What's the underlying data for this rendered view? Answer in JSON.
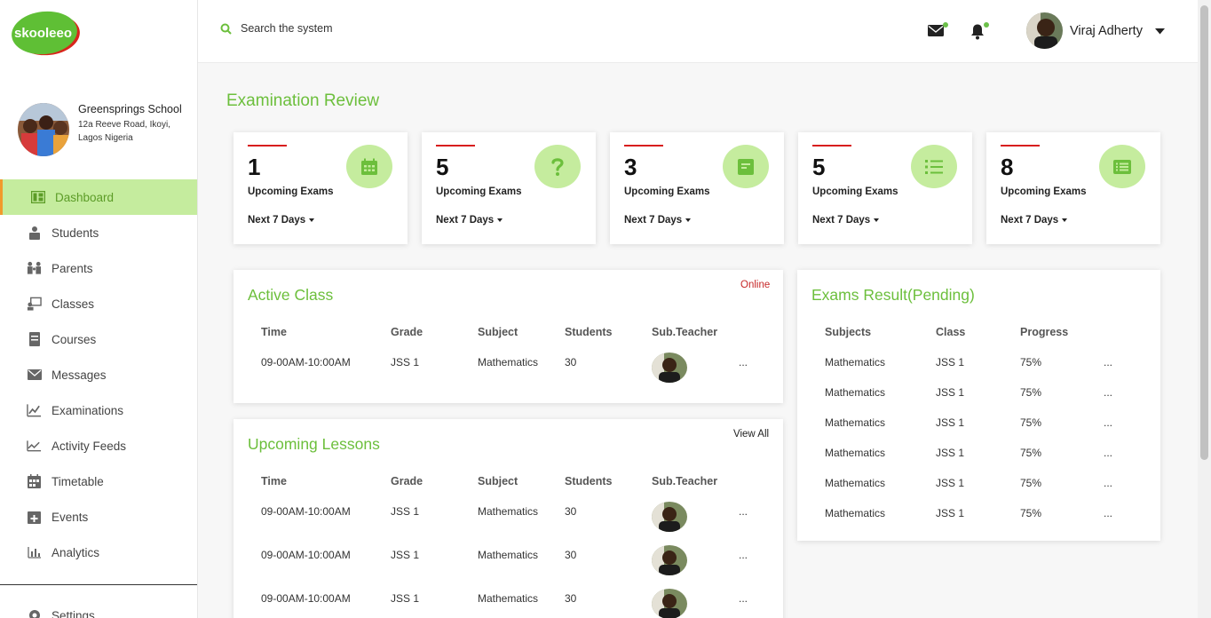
{
  "app": {
    "logo_text": "skooleeo"
  },
  "school": {
    "name": "Greensprings School",
    "address_line1": "12a Reeve Road, Ikoyi,",
    "address_line2": "Lagos Nigeria"
  },
  "sidebar": {
    "items": [
      {
        "label": "Dashboard",
        "icon": "dashboard-icon"
      },
      {
        "label": "Students",
        "icon": "students-icon"
      },
      {
        "label": "Parents",
        "icon": "parents-icon"
      },
      {
        "label": "Classes",
        "icon": "classes-icon"
      },
      {
        "label": "Courses",
        "icon": "courses-icon"
      },
      {
        "label": "Messages",
        "icon": "messages-icon"
      },
      {
        "label": "Examinations",
        "icon": "examinations-icon"
      },
      {
        "label": "Activity Feeds",
        "icon": "activity-icon"
      },
      {
        "label": "Timetable",
        "icon": "timetable-icon"
      },
      {
        "label": "Events",
        "icon": "events-icon"
      },
      {
        "label": "Analytics",
        "icon": "analytics-icon"
      }
    ],
    "settings_label": "Settings"
  },
  "search": {
    "placeholder": "Search the system"
  },
  "user": {
    "name": "Viraj Adherty"
  },
  "page_title": "Examination Review",
  "cards": [
    {
      "count": "1",
      "label": "Upcoming Exams",
      "period": "Next 7 Days",
      "icon": "calendar-icon"
    },
    {
      "count": "5",
      "label": "Upcoming Exams",
      "period": "Next 7 Days",
      "icon": "question-icon"
    },
    {
      "count": "3",
      "label": "Upcoming Exams",
      "period": "Next 7 Days",
      "icon": "document-icon"
    },
    {
      "count": "5",
      "label": "Upcoming Exams",
      "period": "Next 7 Days",
      "icon": "list-icon"
    },
    {
      "count": "8",
      "label": "Upcoming Exams",
      "period": "Next 7 Days",
      "icon": "list-box-icon"
    }
  ],
  "active_class": {
    "title": "Active Class",
    "status": "Online",
    "columns": [
      "Time",
      "Grade",
      "Subject",
      "Students",
      "Sub.Teacher"
    ],
    "rows": [
      {
        "time": "09-00AM-10:00AM",
        "grade": "JSS 1",
        "subject": "Mathematics",
        "students": "30",
        "more": "..."
      }
    ]
  },
  "upcoming_lessons": {
    "title": "Upcoming Lessons",
    "view_all": "View All",
    "columns": [
      "Time",
      "Grade",
      "Subject",
      "Students",
      "Sub.Teacher"
    ],
    "rows": [
      {
        "time": "09-00AM-10:00AM",
        "grade": "JSS 1",
        "subject": "Mathematics",
        "students": "30",
        "more": "..."
      },
      {
        "time": "09-00AM-10:00AM",
        "grade": "JSS 1",
        "subject": "Mathematics",
        "students": "30",
        "more": "..."
      },
      {
        "time": "09-00AM-10:00AM",
        "grade": "JSS 1",
        "subject": "Mathematics",
        "students": "30",
        "more": "..."
      }
    ]
  },
  "exams_result": {
    "title": "Exams Result(Pending)",
    "columns": [
      "Subjects",
      "Class",
      "Progress"
    ],
    "rows": [
      {
        "subject": "Mathematics",
        "class": "JSS 1",
        "progress": "75%",
        "more": "..."
      },
      {
        "subject": "Mathematics",
        "class": "JSS 1",
        "progress": "75%",
        "more": "..."
      },
      {
        "subject": "Mathematics",
        "class": "JSS 1",
        "progress": "75%",
        "more": "..."
      },
      {
        "subject": "Mathematics",
        "class": "JSS 1",
        "progress": "75%",
        "more": "..."
      },
      {
        "subject": "Mathematics",
        "class": "JSS 1",
        "progress": "75%",
        "more": "..."
      },
      {
        "subject": "Mathematics",
        "class": "JSS 1",
        "progress": "75%",
        "more": "..."
      }
    ]
  },
  "colors": {
    "brand_green": "#6cbf3c",
    "light_green": "#c5ec9e",
    "accent_red": "#d81e1e",
    "active_border": "#f19a2b",
    "status_red": "#c62828"
  }
}
